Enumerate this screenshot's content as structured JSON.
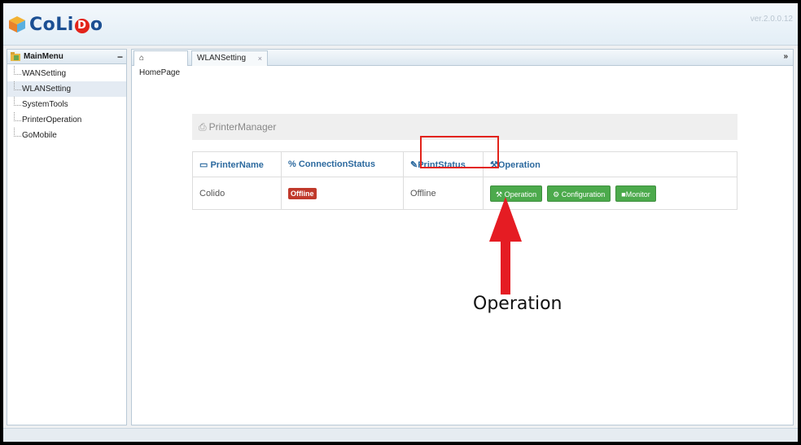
{
  "app": {
    "logo_text_1": "CoLi",
    "logo_badge": "D",
    "logo_text_2": "o",
    "version": "ver.2.0.0.12"
  },
  "sidebar": {
    "title": "MainMenu",
    "collapse_icon": "−",
    "items": [
      {
        "label": "WANSetting"
      },
      {
        "label": "WLANSetting"
      },
      {
        "label": "SystemTools"
      },
      {
        "label": "PrinterOperation"
      },
      {
        "label": "GoMobile"
      }
    ]
  },
  "tabs": {
    "home_label": "HomePage",
    "wlan_label": "WLANSetting",
    "close_icon": "×",
    "more_icon": "»"
  },
  "main": {
    "section_title": "PrinterManager",
    "table": {
      "headers": [
        "PrinterName",
        "ConnectionStatus",
        "PrintStatus",
        "Operation"
      ],
      "rows": [
        {
          "name": "Colido",
          "connection": "Offline",
          "print_status": "Offline"
        }
      ]
    },
    "buttons": {
      "operation": "Operation",
      "configuration": "Configuration",
      "monitor": "Monitor"
    }
  },
  "annotation": {
    "label": "Operation"
  },
  "colors": {
    "accent": "#2d6a9f",
    "button_green": "#4caa4c",
    "offline_red": "#c0392b",
    "highlight_red": "#e2231a"
  }
}
